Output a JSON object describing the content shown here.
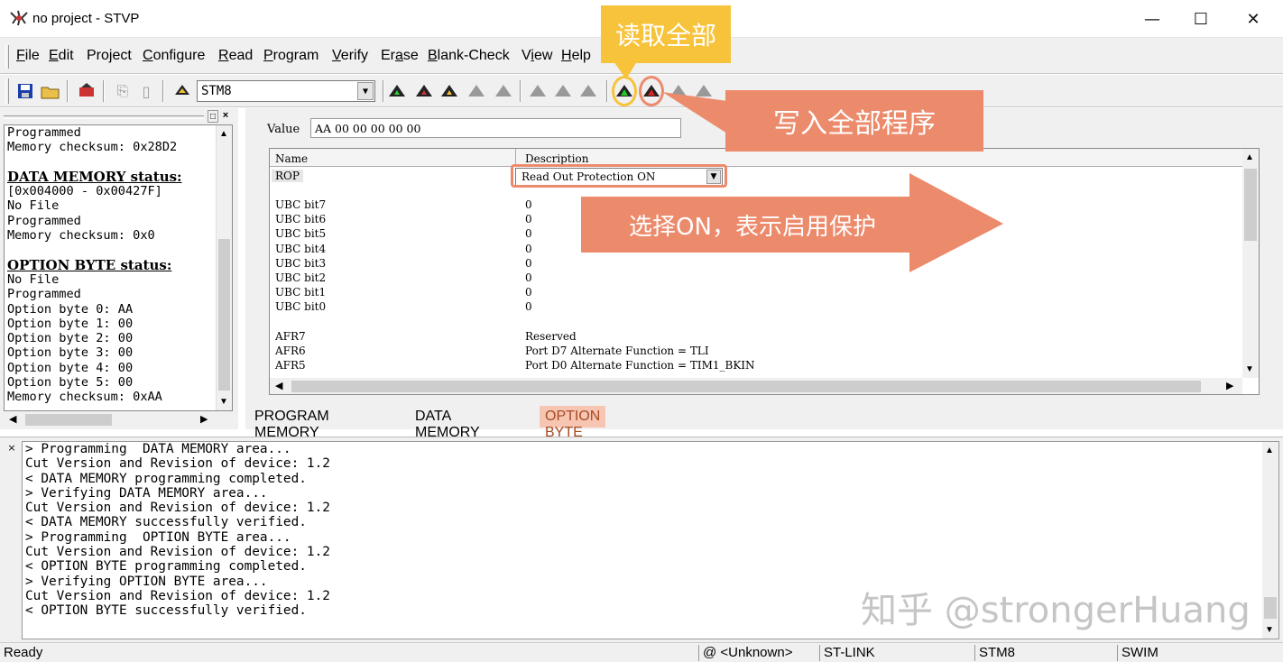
{
  "window": {
    "title": "no project - STVP",
    "minimize": "—",
    "maximize": "☐",
    "close": "✕"
  },
  "menu": [
    {
      "u": "F",
      "rest": "ile"
    },
    {
      "u": "E",
      "rest": "dit"
    },
    {
      "pre": "Pro",
      "u": "j",
      "rest": "ect"
    },
    {
      "u": "C",
      "rest": "onfigure"
    },
    {
      "u": "R",
      "rest": "ead"
    },
    {
      "u": "P",
      "rest": "rogram"
    },
    {
      "u": "V",
      "rest": "erify"
    },
    {
      "pre": "Er",
      "u": "a",
      "rest": "se"
    },
    {
      "u": "B",
      "rest": "lank-Check"
    },
    {
      "pre": "V",
      "u": "i",
      "rest": "ew"
    },
    {
      "u": "H",
      "rest": "elp"
    }
  ],
  "toolbar": {
    "device": "STM8"
  },
  "left_status": [
    {
      "text": "Programmed"
    },
    {
      "text": "Memory checksum: 0x28D2"
    },
    {
      "text": ""
    },
    {
      "text": "DATA MEMORY status:",
      "bold": true
    },
    {
      "text": "[0x004000 - 0x00427F]"
    },
    {
      "text": "No File"
    },
    {
      "text": "Programmed"
    },
    {
      "text": "Memory checksum: 0x0"
    },
    {
      "text": ""
    },
    {
      "text": "OPTION BYTE status:",
      "bold": true
    },
    {
      "text": "No File"
    },
    {
      "text": "Programmed"
    },
    {
      "text": "Option byte 0: AA"
    },
    {
      "text": "Option byte 1: 00"
    },
    {
      "text": "Option byte 2: 00"
    },
    {
      "text": "Option byte 3: 00"
    },
    {
      "text": "Option byte 4: 00"
    },
    {
      "text": "Option byte 5: 00"
    },
    {
      "text": "Memory checksum: 0xAA"
    }
  ],
  "option_panel": {
    "value_label": "Value",
    "value": "AA 00 00 00 00 00",
    "col_name": "Name",
    "col_desc": "Description",
    "rop_name": "ROP",
    "rop_value": "Read Out Protection ON",
    "rows": [
      {
        "name": "UBC bit7",
        "desc": "0"
      },
      {
        "name": "UBC bit6",
        "desc": "0"
      },
      {
        "name": "UBC bit5",
        "desc": "0"
      },
      {
        "name": "UBC bit4",
        "desc": "0"
      },
      {
        "name": "UBC bit3",
        "desc": "0"
      },
      {
        "name": "UBC bit2",
        "desc": "0"
      },
      {
        "name": "UBC bit1",
        "desc": "0"
      },
      {
        "name": "UBC bit0",
        "desc": "0"
      },
      {
        "name": "",
        "desc": ""
      },
      {
        "name": "AFR7",
        "desc": "Reserved"
      },
      {
        "name": "AFR6",
        "desc": "Port D7 Alternate Function = TLI"
      },
      {
        "name": "AFR5",
        "desc": "Port D0 Alternate Function = TIM1_BKIN"
      }
    ]
  },
  "tabs": [
    "PROGRAM MEMORY",
    "DATA MEMORY",
    "OPTION BYTE"
  ],
  "log": [
    "> Programming  DATA MEMORY area...",
    "Cut Version and Revision of device: 1.2",
    "< DATA MEMORY programming completed.",
    "> Verifying DATA MEMORY area...",
    "Cut Version and Revision of device: 1.2",
    "< DATA MEMORY successfully verified.",
    "> Programming  OPTION BYTE area...",
    "Cut Version and Revision of device: 1.2",
    "< OPTION BYTE programming completed.",
    "> Verifying OPTION BYTE area...",
    "Cut Version and Revision of device: 1.2",
    "< OPTION BYTE successfully verified."
  ],
  "status": {
    "ready": "Ready",
    "port": "@ <Unknown>",
    "tool": "ST-LINK",
    "device": "STM8",
    "protocol": "SWIM"
  },
  "annotations": {
    "read_all": "读取全部",
    "write_all": "写入全部程序",
    "select_on": "选择ON，表示启用保护",
    "watermark": "知乎 @strongerHuang",
    "read_color": "#f7c33a",
    "write_color": "#ec8a6c"
  }
}
